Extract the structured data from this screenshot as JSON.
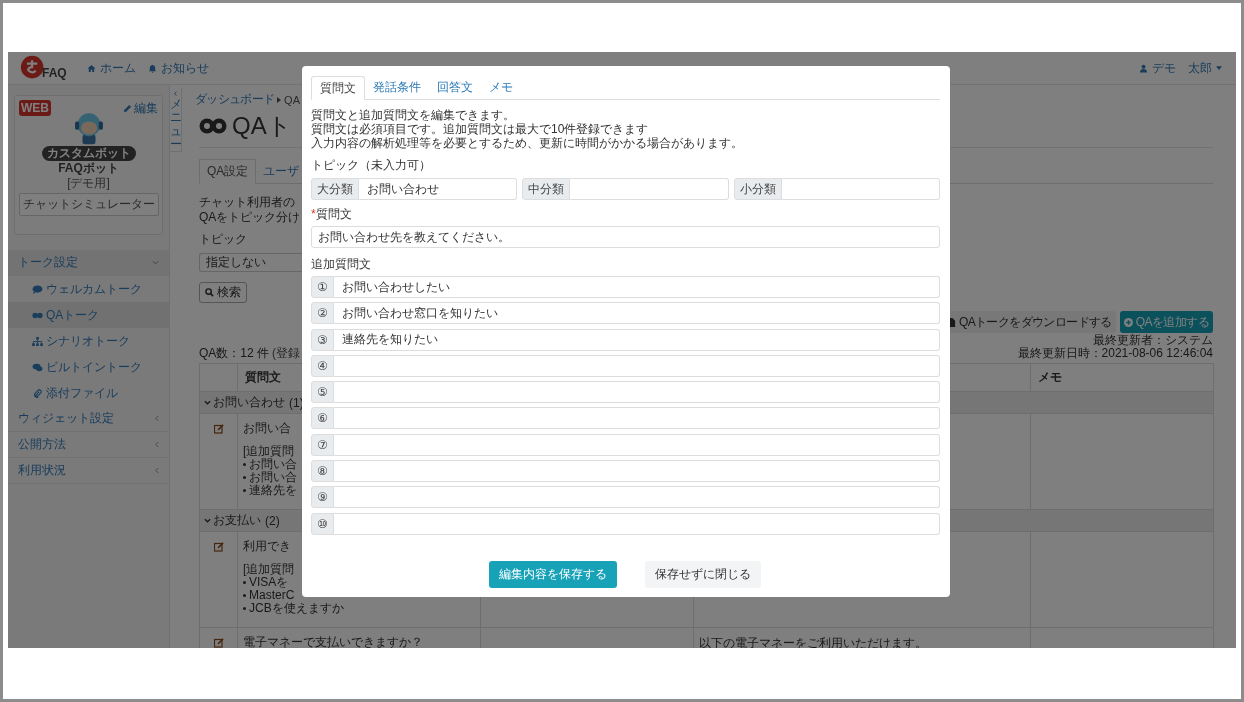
{
  "header": {
    "logo_text": "FAQ",
    "nav": [
      {
        "label": "ホーム"
      },
      {
        "label": "お知らせ"
      }
    ],
    "user": "デモ　太郎"
  },
  "bot_card": {
    "badge": "WEB",
    "edit": "編集",
    "tag": "カスタムボット",
    "name": "FAQボット",
    "note": "[デモ用]",
    "simulator": "チャットシミュレーター"
  },
  "sidebar": {
    "toggle": "メニュー",
    "groups": [
      {
        "label": "トーク設定",
        "expanded": true,
        "children": [
          {
            "label": "ウェルカムトーク",
            "selected": false
          },
          {
            "label": "QAトーク",
            "selected": true
          },
          {
            "label": "シナリオトーク",
            "selected": false
          },
          {
            "label": "ビルトイントーク",
            "selected": false
          },
          {
            "label": "添付ファイル",
            "selected": false
          }
        ]
      },
      {
        "label": "ウィジェット設定",
        "expanded": false
      },
      {
        "label": "公開方法",
        "expanded": false
      },
      {
        "label": "利用状況",
        "expanded": false
      }
    ]
  },
  "main": {
    "breadcrumb": [
      "ダッシュボード",
      "QA"
    ],
    "title": "QAト",
    "tabs": [
      {
        "label": "QA設定",
        "selected": true
      },
      {
        "label": "ユーザ",
        "selected": false
      }
    ],
    "description": [
      "チャット利用者の",
      "QAをトピック分け"
    ],
    "topic_label": "トピック",
    "topic_select": "指定しない",
    "search_button": "検索",
    "download_button": "QAトークをダウンロードする",
    "add_button": "QAを追加する",
    "qa_count": "QA数：12 件",
    "qa_count_note": "(登録",
    "updated": [
      "最終更新者：システム",
      "最終更新日時：2021-08-06 12:46:04"
    ],
    "table": {
      "question_header": "質問文",
      "memo_header": "メモ",
      "groups": [
        {
          "label": "お問い合わせ",
          "count": "(1)",
          "expanded": true,
          "rows": [
            {
              "question": "お問い合",
              "extra_label": "[追加質問",
              "extras": [
                "お問い合",
                "お問い合",
                "連絡先を"
              ]
            }
          ]
        },
        {
          "label": "お支払い",
          "count": "(2)",
          "expanded": true,
          "rows": [
            {
              "question": "利用でき",
              "extra_label": "[追加質問",
              "extras": [
                "VISAを",
                "MasterC",
                "JCBを使えますか"
              ]
            },
            {
              "question": "電子マネーで支払いできますか？",
              "answer": "以下の電子マネーをご利用いただけます。"
            }
          ]
        }
      ]
    }
  },
  "modal": {
    "tabs": [
      {
        "label": "質問文",
        "selected": true
      },
      {
        "label": "発話条件",
        "selected": false
      },
      {
        "label": "回答文",
        "selected": false
      },
      {
        "label": "メモ",
        "selected": false
      }
    ],
    "description": [
      "質問文と追加質問文を編集できます。",
      "質問文は必須項目です。追加質問文は最大で10件登録できます",
      "入力内容の解析処理等を必要とするため、更新に時間がかかる場合があります。"
    ],
    "topic_label": "トピック（未入力可）",
    "topics": [
      {
        "label": "大分類",
        "value": "お問い合わせ"
      },
      {
        "label": "中分類"
      },
      {
        "label": "小分類"
      }
    ],
    "required_mark": "*",
    "question_label": "質問文",
    "question_value": "お問い合わせ先を教えてください。",
    "extra_label": "追加質問文",
    "extras": [
      {
        "num": "①",
        "value": "お問い合わせしたい"
      },
      {
        "num": "②",
        "value": "お問い合わせ窓口を知りたい"
      },
      {
        "num": "③",
        "value": "連絡先を知りたい"
      },
      {
        "num": "④"
      },
      {
        "num": "⑤"
      },
      {
        "num": "⑥"
      },
      {
        "num": "⑦"
      },
      {
        "num": "⑧"
      },
      {
        "num": "⑨"
      },
      {
        "num": "⑩"
      }
    ],
    "save_button": "編集内容を保存する",
    "close_button": "保存せずに閉じる"
  }
}
